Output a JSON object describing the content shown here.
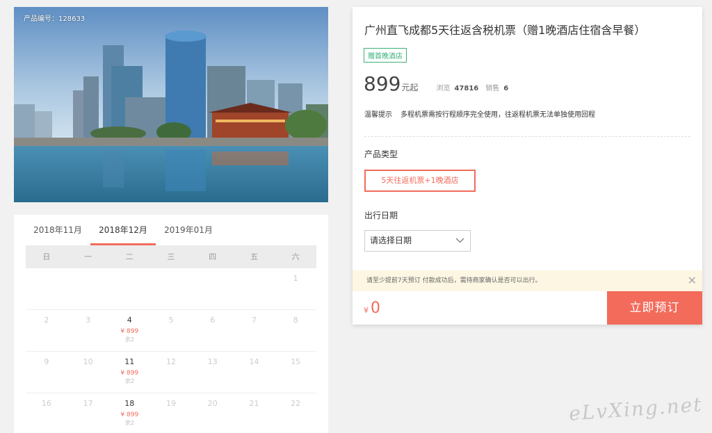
{
  "product": {
    "id_label": "产品编号：128633",
    "title": "广州直飞成都5天往返含税机票（赠1晚酒店住宿含早餐）",
    "badge": "赠首晚酒店",
    "price": "899",
    "price_unit": "元起",
    "views_label": "浏览",
    "views": "47816",
    "sales_label": "销售",
    "sales": "6",
    "tips_label": "温馨提示",
    "tips_text": "多程机票需按行程顺序完全使用，往返程机票无法单独使用回程",
    "type_section": "产品类型",
    "type_option": "5天往返机票+1晚酒店",
    "date_section": "出行日期",
    "date_placeholder": "请选择日期",
    "notice": "请至少提前7天预订 付款成功后，需待商家确认是否可以出行。",
    "total_currency": "¥",
    "total_amount": "0",
    "book_label": "立即预订"
  },
  "calendar": {
    "tabs": [
      "2018年11月",
      "2018年12月",
      "2019年01月"
    ],
    "active_tab": 1,
    "weekdays": [
      "日",
      "一",
      "二",
      "三",
      "四",
      "五",
      "六"
    ],
    "rows": [
      [
        {
          "d": ""
        },
        {
          "d": ""
        },
        {
          "d": ""
        },
        {
          "d": ""
        },
        {
          "d": ""
        },
        {
          "d": ""
        },
        {
          "d": "1"
        }
      ],
      [
        {
          "d": "2"
        },
        {
          "d": "3"
        },
        {
          "d": "4",
          "price": "¥ 899",
          "stock": "余2"
        },
        {
          "d": "5"
        },
        {
          "d": "6"
        },
        {
          "d": "7"
        },
        {
          "d": "8"
        }
      ],
      [
        {
          "d": "9"
        },
        {
          "d": "10"
        },
        {
          "d": "11",
          "price": "¥ 899",
          "stock": "余2"
        },
        {
          "d": "12"
        },
        {
          "d": "13"
        },
        {
          "d": "14"
        },
        {
          "d": "15"
        }
      ],
      [
        {
          "d": "16"
        },
        {
          "d": "17"
        },
        {
          "d": "18",
          "price": "¥ 899",
          "stock": "余2"
        },
        {
          "d": "19"
        },
        {
          "d": "20"
        },
        {
          "d": "21"
        },
        {
          "d": "22"
        }
      ]
    ]
  },
  "watermark": "eLvXing.net",
  "colors": {
    "accent": "#f26b5b",
    "badge": "#3ab07a"
  }
}
